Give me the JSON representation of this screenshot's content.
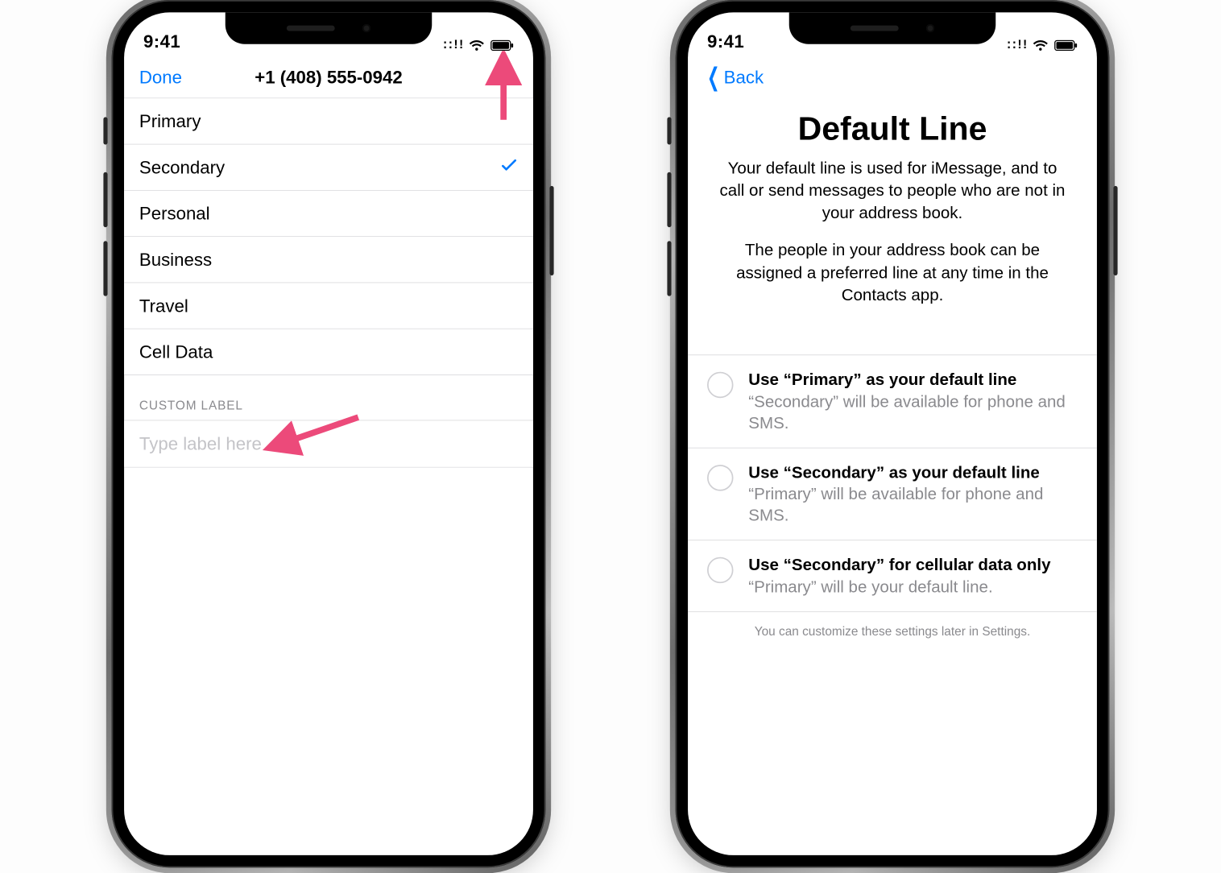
{
  "statusbar": {
    "time": "9:41"
  },
  "left": {
    "nav": {
      "done": "Done",
      "title": "+1 (408) 555-0942"
    },
    "labels": [
      {
        "text": "Primary",
        "selected": false
      },
      {
        "text": "Secondary",
        "selected": true
      },
      {
        "text": "Personal",
        "selected": false
      },
      {
        "text": "Business",
        "selected": false
      },
      {
        "text": "Travel",
        "selected": false
      },
      {
        "text": "Cell Data",
        "selected": false
      }
    ],
    "custom_header": "CUSTOM LABEL",
    "custom_placeholder": "Type label here"
  },
  "right": {
    "nav": {
      "back": "Back"
    },
    "title": "Default Line",
    "blurb1": "Your default line is used for iMessage, and to call or send messages to people who are not in your address book.",
    "blurb2": "The people in your address book can be assigned a preferred line at any time in the Contacts app.",
    "options": [
      {
        "title": "Use “Primary” as your default line",
        "sub": "“Secondary” will be available for phone and SMS."
      },
      {
        "title": "Use “Secondary” as your default line",
        "sub": "“Primary” will be available for phone and SMS."
      },
      {
        "title": "Use “Secondary” for cellular data only",
        "sub": "“Primary” will be your default line."
      }
    ],
    "footnote": "You can customize these settings later in Settings."
  }
}
